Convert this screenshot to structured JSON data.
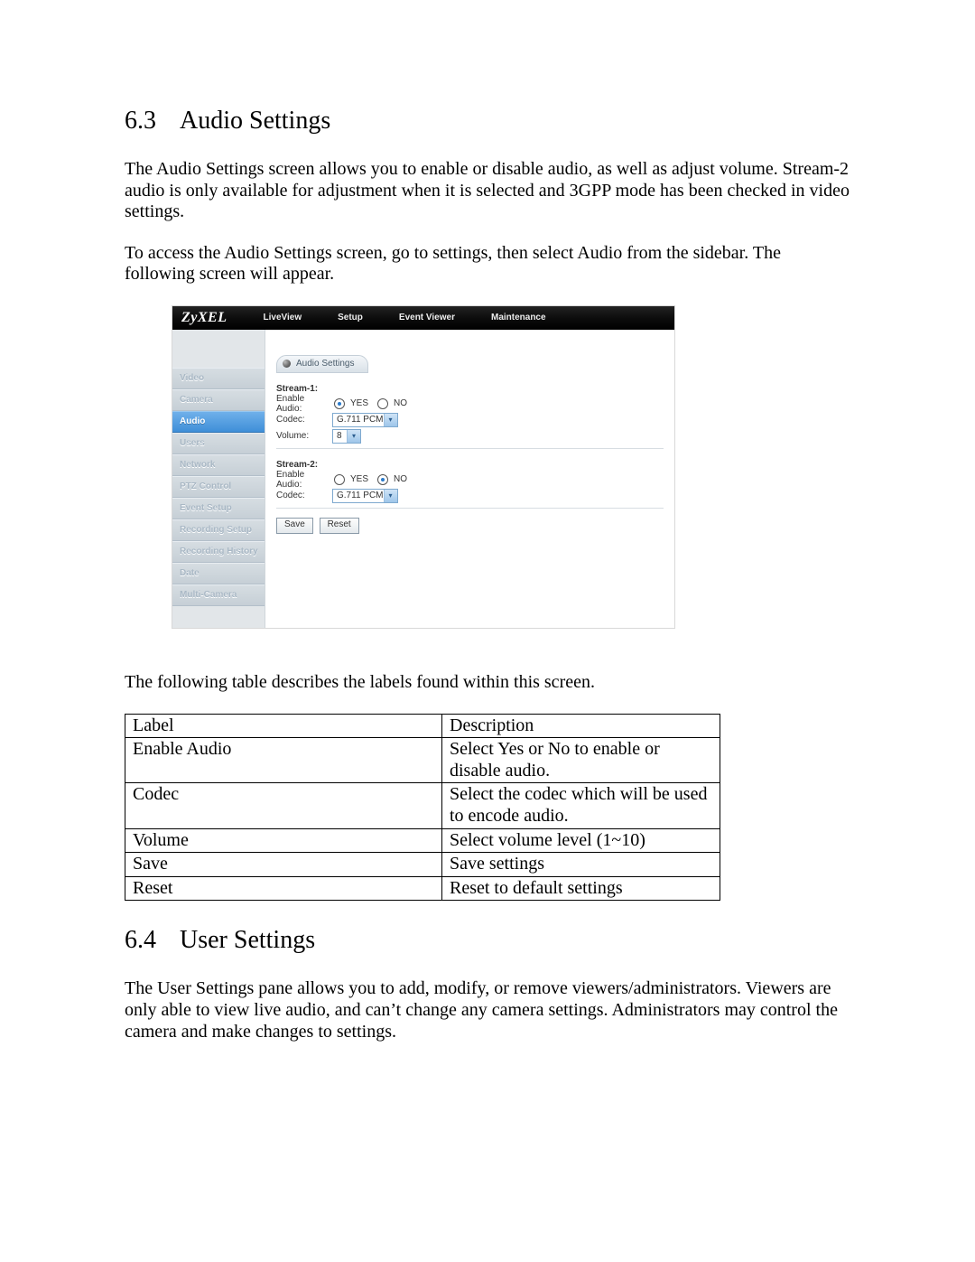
{
  "section63": {
    "number": "6.3",
    "title": "Audio Settings",
    "para1": "The Audio Settings screen allows you to enable or disable audio, as well as adjust volume. Stream-2 audio is only available for adjustment when it is selected and 3GPP mode has been checked in video settings.",
    "para2": "To access the Audio Settings screen, go to settings, then select Audio from the sidebar. The following screen will appear.",
    "after_shot": "The following table describes the labels found within this screen."
  },
  "shot": {
    "brand": "ZyXEL",
    "topnav": [
      "LiveView",
      "Setup",
      "Event Viewer",
      "Maintenance"
    ],
    "sidebar": [
      "Video",
      "Camera",
      "Audio",
      "Users",
      "Network",
      "PTZ Control",
      "Event Setup",
      "Recording Setup",
      "Recording History",
      "Date",
      "Multi-Camera"
    ],
    "active_sidebar_index": 2,
    "tab_label": "Audio Settings",
    "stream1": {
      "title": "Stream-1:",
      "enable_label": "Enable Audio:",
      "yes": "YES",
      "no": "NO",
      "enable_value": "YES",
      "codec_label": "Codec:",
      "codec_value": "G.711 PCM",
      "volume_label": "Volume:",
      "volume_value": "8"
    },
    "stream2": {
      "title": "Stream-2:",
      "enable_label": "Enable Audio:",
      "yes": "YES",
      "no": "NO",
      "enable_value": "NO",
      "codec_label": "Codec:",
      "codec_value": "G.711 PCM"
    },
    "buttons": {
      "save": "Save",
      "reset": "Reset"
    }
  },
  "table": {
    "header": {
      "label": "Label",
      "desc": "Description"
    },
    "rows": [
      {
        "label": "Enable Audio",
        "desc": "Select Yes or No to enable or disable audio."
      },
      {
        "label": "Codec",
        "desc": "Select the codec which will be used to encode audio."
      },
      {
        "label": "Volume",
        "desc": "Select volume level (1~10)"
      },
      {
        "label": "Save",
        "desc": "Save settings"
      },
      {
        "label": "Reset",
        "desc": "Reset to default settings"
      }
    ]
  },
  "section64": {
    "number": "6.4",
    "title": "User Settings",
    "para1": "The User Settings pane allows you to add, modify, or remove viewers/administrators. Viewers are only able to view live audio, and can’t change any camera settings. Administrators may control the camera and make changes to settings."
  }
}
